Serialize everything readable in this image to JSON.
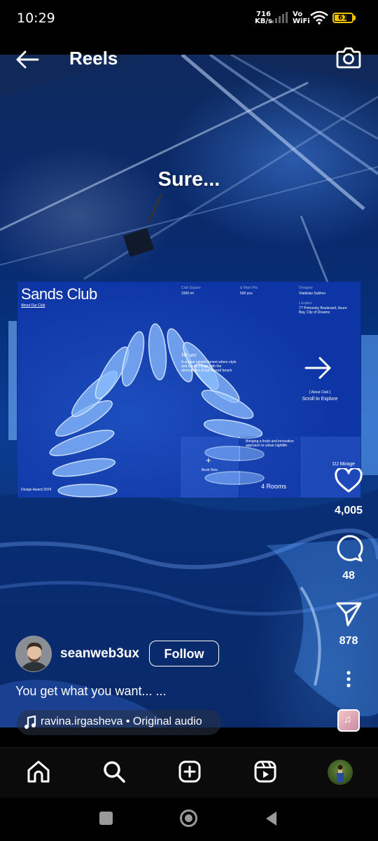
{
  "status_bar": {
    "time": "10:29",
    "speed_value": "716",
    "speed_unit": "KB/s",
    "vo": "Vo",
    "wifi_label": "WiFi",
    "battery": "61"
  },
  "header": {
    "title": "Reels",
    "back_icon": "arrow-left-icon",
    "camera_icon": "camera-icon"
  },
  "reel": {
    "overlay_text": "Sure...",
    "site": {
      "title": "Sands Club",
      "about_link": "About Our Club",
      "club_square_label": "Club Square",
      "club_square_value": "1000 m²",
      "main_pits_label": "& Main Pits",
      "main_pits_value": "500 pcs.",
      "designer_label": "Designer",
      "designer_value": "Vladislav Sukhov",
      "location_label": "Location",
      "location_value": "77 Primorsky Boulevard, Azure Bay, City of Dreams",
      "we_are": "We are",
      "description": "A unique establishment where style and luxury merge with the atmosphere of sun-kissed beach.",
      "about_club": "[ About Club ]",
      "scroll": "Scroll to Explore",
      "book_now": "Book Now",
      "mid_text": "Bringing a fresh and innovative approach to urban nightlife.",
      "rooms": "4 Rooms",
      "dj": "DJ Mirage",
      "design_award": "Design Award 2024"
    }
  },
  "actions": {
    "likes": "4,005",
    "comments": "48",
    "shares": "878"
  },
  "author": {
    "username": "seanweb3ux",
    "follow_label": "Follow",
    "caption": "You get what you want... ...",
    "audio": "ravina.irgasheva • Original audio"
  },
  "nav": {
    "items": [
      "home-icon",
      "search-icon",
      "create-icon",
      "reels-icon",
      "profile-avatar"
    ]
  },
  "colors": {
    "battery": "#f2c200",
    "reel_blue": "#0a3d95",
    "nav_bg": "#0b0b0b"
  }
}
